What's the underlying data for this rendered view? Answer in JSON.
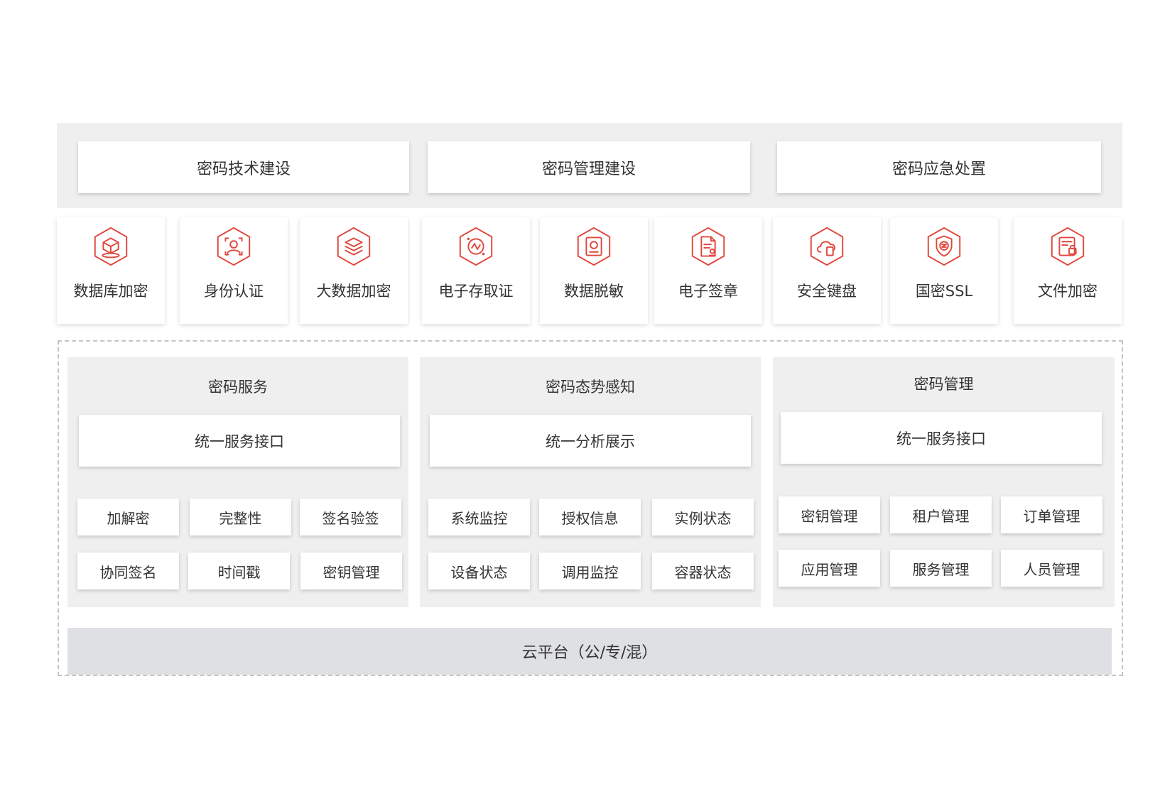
{
  "top": {
    "items": [
      "密码技术建设",
      "密码管理建设",
      "密码应急处置"
    ]
  },
  "products": [
    {
      "label": "数据库加密",
      "icon": "database-icon"
    },
    {
      "label": "身份认证",
      "icon": "identity-icon"
    },
    {
      "label": "大数据加密",
      "icon": "layers-icon"
    },
    {
      "label": "电子存取证",
      "icon": "evidence-icon"
    },
    {
      "label": "数据脱敏",
      "icon": "mask-icon"
    },
    {
      "label": "电子签章",
      "icon": "seal-document-icon"
    },
    {
      "label": "安全键盘",
      "icon": "cloud-device-icon"
    },
    {
      "label": "国密SSL",
      "icon": "shield-icon"
    },
    {
      "label": "文件加密",
      "icon": "file-lock-icon"
    }
  ],
  "columns": [
    {
      "title": "密码服务",
      "interface": "统一服务接口",
      "buttons": [
        "加解密",
        "完整性",
        "签名验签",
        "协同签名",
        "时间戳",
        "密钥管理"
      ]
    },
    {
      "title": "密码态势感知",
      "interface": "统一分析展示",
      "buttons": [
        "系统监控",
        "授权信息",
        "实例状态",
        "设备状态",
        "调用监控",
        "容器状态"
      ]
    },
    {
      "title": "密码管理",
      "interface": "统一服务接口",
      "buttons": [
        "密钥管理",
        "租户管理",
        "订单管理",
        "应用管理",
        "服务管理",
        "人员管理"
      ]
    }
  ],
  "cloud": {
    "label": "云平台（公/专/混）"
  },
  "colors": {
    "accent": "#e1473d",
    "panel": "#efefef",
    "cloud": "#dfe0e3"
  }
}
